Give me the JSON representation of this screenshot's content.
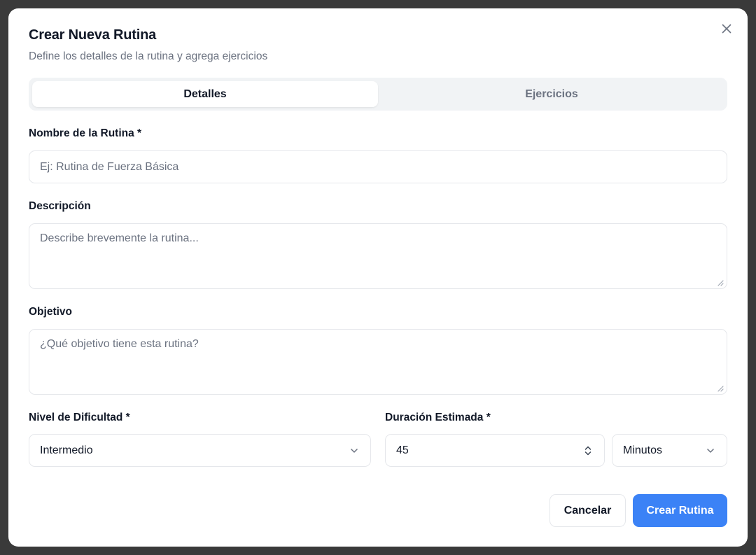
{
  "dialog": {
    "title": "Crear Nueva Rutina",
    "subtitle": "Define los detalles de la rutina y agrega ejercicios",
    "close_icon": "close-icon"
  },
  "tabs": [
    {
      "label": "Detalles",
      "active": true
    },
    {
      "label": "Ejercicios",
      "active": false
    }
  ],
  "form": {
    "name": {
      "label": "Nombre de la Rutina *",
      "value": "",
      "placeholder": "Ej: Rutina de Fuerza Básica"
    },
    "description": {
      "label": "Descripción",
      "value": "",
      "placeholder": "Describe brevemente la rutina..."
    },
    "objective": {
      "label": "Objetivo",
      "value": "",
      "placeholder": "¿Qué objetivo tiene esta rutina?"
    },
    "difficulty": {
      "label": "Nivel de Dificultad *",
      "selected": "Intermedio"
    },
    "duration": {
      "label": "Duración Estimada *",
      "value": "45",
      "unit_selected": "Minutos"
    }
  },
  "actions": {
    "cancel_label": "Cancelar",
    "submit_label": "Crear Rutina"
  },
  "colors": {
    "primary": "#3b82f6",
    "muted_text": "#6b7280",
    "border": "#e5e7eb",
    "tab_track": "#f1f3f5"
  }
}
